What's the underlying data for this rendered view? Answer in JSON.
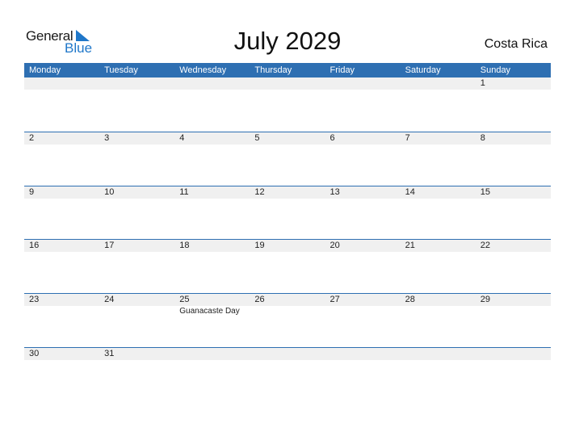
{
  "logo": {
    "line1": "General",
    "line2": "Blue"
  },
  "title": "July 2029",
  "country": "Costa Rica",
  "colors": {
    "accent": "#2e6fb2",
    "logo_blue": "#1f77c9",
    "row_band": "#f0f0f0"
  },
  "weekdays": [
    "Monday",
    "Tuesday",
    "Wednesday",
    "Thursday",
    "Friday",
    "Saturday",
    "Sunday"
  ],
  "weeks": [
    [
      {
        "d": ""
      },
      {
        "d": ""
      },
      {
        "d": ""
      },
      {
        "d": ""
      },
      {
        "d": ""
      },
      {
        "d": ""
      },
      {
        "d": "1"
      }
    ],
    [
      {
        "d": "2"
      },
      {
        "d": "3"
      },
      {
        "d": "4"
      },
      {
        "d": "5"
      },
      {
        "d": "6"
      },
      {
        "d": "7"
      },
      {
        "d": "8"
      }
    ],
    [
      {
        "d": "9"
      },
      {
        "d": "10"
      },
      {
        "d": "11"
      },
      {
        "d": "12"
      },
      {
        "d": "13"
      },
      {
        "d": "14"
      },
      {
        "d": "15"
      }
    ],
    [
      {
        "d": "16"
      },
      {
        "d": "17"
      },
      {
        "d": "18"
      },
      {
        "d": "19"
      },
      {
        "d": "20"
      },
      {
        "d": "21"
      },
      {
        "d": "22"
      }
    ],
    [
      {
        "d": "23"
      },
      {
        "d": "24"
      },
      {
        "d": "25",
        "event": "Guanacaste Day"
      },
      {
        "d": "26"
      },
      {
        "d": "27"
      },
      {
        "d": "28"
      },
      {
        "d": "29"
      }
    ],
    [
      {
        "d": "30"
      },
      {
        "d": "31"
      },
      {
        "d": ""
      },
      {
        "d": ""
      },
      {
        "d": ""
      },
      {
        "d": ""
      },
      {
        "d": ""
      }
    ]
  ]
}
